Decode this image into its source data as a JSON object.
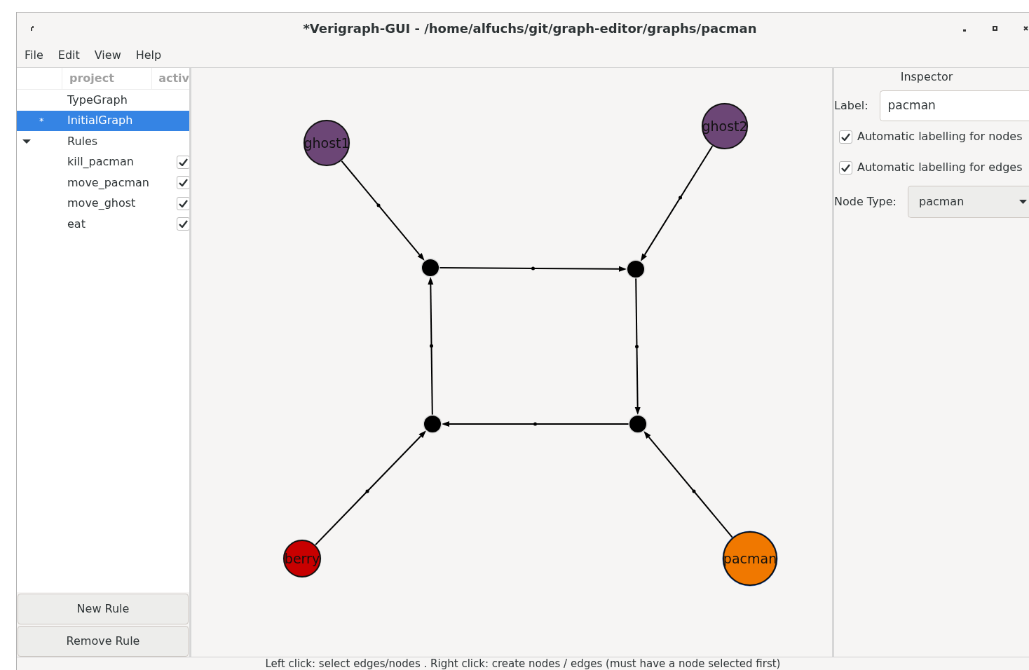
{
  "window": {
    "title": "*Verigraph-GUI - /home/alfuchs/git/graph-editor/graphs/pacman"
  },
  "menu": [
    "File",
    "Edit",
    "View",
    "Help"
  ],
  "project_tree": {
    "columns": [
      "project",
      "activ"
    ],
    "items": [
      {
        "label": "TypeGraph",
        "selected": false
      },
      {
        "label": "InitialGraph",
        "marker": "*",
        "selected": true
      },
      {
        "label": "Rules",
        "selected": false,
        "expanded": true,
        "children": [
          {
            "label": "kill_pacman",
            "checked": true,
            "selected": false
          },
          {
            "label": "move_pacman",
            "checked": true,
            "selected": false
          },
          {
            "label": "move_ghost",
            "checked": true,
            "selected": false
          },
          {
            "label": "eat",
            "checked": true,
            "selected": false
          }
        ]
      }
    ]
  },
  "buttons": [
    "New Rule",
    "Remove Rule"
  ],
  "graph": {
    "nodes": [
      {
        "kind": "typed",
        "label": "ghost1",
        "color": "#6c4676",
        "selected": false
      },
      {
        "kind": "typed",
        "label": "ghost2",
        "color": "#6c4676",
        "selected": false
      },
      {
        "kind": "point",
        "selected": false
      },
      {
        "kind": "point",
        "selected": false
      },
      {
        "kind": "point",
        "selected": false
      },
      {
        "kind": "point",
        "selected": false
      },
      {
        "kind": "typed",
        "label": "berry",
        "color": "#c80000",
        "selected": false
      },
      {
        "kind": "typed",
        "label": "pacman",
        "color": "#f07800",
        "selected": true
      }
    ]
  },
  "inspector": {
    "title": "Inspector",
    "label_field": {
      "label": "Label:",
      "value": "pacman"
    },
    "options": [
      {
        "label": "Automatic labelling for nodes",
        "checked": true
      },
      {
        "label": "Automatic labelling for edges",
        "checked": true
      }
    ],
    "node_type": {
      "label": "Node Type:",
      "value": "pacman"
    }
  },
  "status_bar": "Left click: select edges/nodes . Right click: create nodes / edges (must have a node selected first)"
}
